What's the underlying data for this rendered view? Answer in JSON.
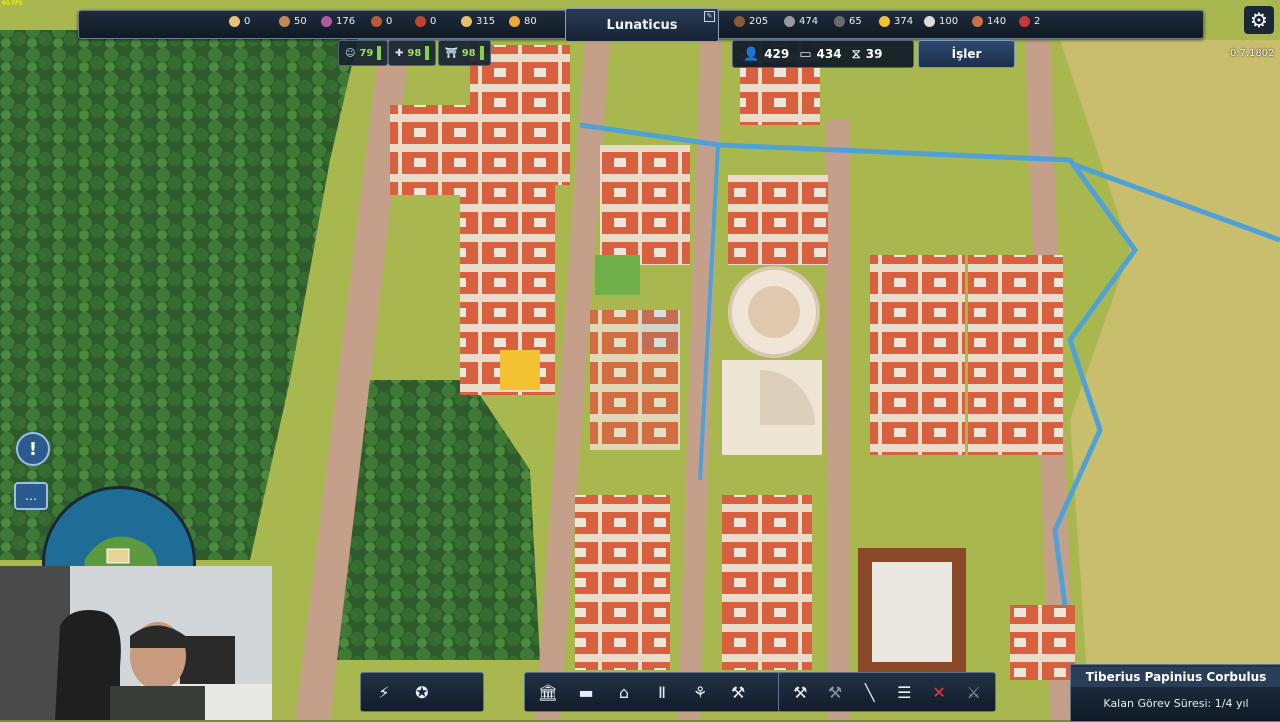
{
  "fps_text": "60 FPS",
  "city": {
    "name": "Lunaticus"
  },
  "resources_left": [
    {
      "icon": "bread-icon",
      "value": "0",
      "color": "#e8c07a"
    },
    {
      "icon": "amphora-icon",
      "value": "50",
      "color": "#c48a5a"
    },
    {
      "icon": "grapes-icon",
      "value": "176",
      "color": "#b05a9a"
    },
    {
      "icon": "pottery-icon",
      "value": "0",
      "color": "#b65a3a"
    },
    {
      "icon": "meat-icon",
      "value": "0",
      "color": "#c0452e"
    },
    {
      "icon": "wheat-icon",
      "value": "315",
      "color": "#e3c16a"
    },
    {
      "icon": "fish-icon",
      "value": "80",
      "color": "#e8a83a"
    }
  ],
  "resources_right": [
    {
      "icon": "wood-icon",
      "value": "205",
      "color": "#8a5a32"
    },
    {
      "icon": "stone-icon",
      "value": "474",
      "color": "#9a9a9a"
    },
    {
      "icon": "iron-icon",
      "value": "65",
      "color": "#6b6b6b"
    },
    {
      "icon": "coin-icon",
      "value": "374",
      "color": "#f2c230"
    },
    {
      "icon": "marble-icon",
      "value": "100",
      "color": "#dcdcdc"
    },
    {
      "icon": "clay-icon",
      "value": "140",
      "color": "#c8704a"
    },
    {
      "icon": "wine-icon",
      "value": "2",
      "color": "#c23a3a"
    }
  ],
  "stats": [
    {
      "icon": "happiness-icon",
      "value": "79"
    },
    {
      "icon": "health-icon",
      "value": "98"
    },
    {
      "icon": "culture-icon",
      "value": "98"
    }
  ],
  "population": [
    {
      "icon": "person-icon",
      "glyph": "👤",
      "value": "429"
    },
    {
      "icon": "bed-icon",
      "glyph": "▭",
      "value": "434"
    },
    {
      "icon": "workers-icon",
      "glyph": "⧖",
      "value": "39"
    }
  ],
  "jobs_button": "İşler",
  "version": "0.7.1802",
  "alert_glyph": "!",
  "chat_glyph": "…",
  "bottom_left_buttons": [
    {
      "name": "lightning-button",
      "glyph": "⚡"
    },
    {
      "name": "star-wreath-button",
      "glyph": "✪"
    }
  ],
  "build_buttons": [
    {
      "name": "temple-button",
      "glyph": "🏛"
    },
    {
      "name": "wall-button",
      "glyph": "▬"
    },
    {
      "name": "gate-button",
      "glyph": "⌂"
    },
    {
      "name": "column-button",
      "glyph": "Ⅱ"
    },
    {
      "name": "wheat-button",
      "glyph": "⚘"
    },
    {
      "name": "hammer-button",
      "glyph": "⚒"
    }
  ],
  "tool_buttons": [
    {
      "name": "build-tools-button",
      "glyph": "⚒",
      "state": "normal"
    },
    {
      "name": "demolish-button",
      "glyph": "⚒",
      "state": "disabled"
    },
    {
      "name": "road-button",
      "glyph": "╲",
      "state": "normal"
    },
    {
      "name": "aqueduct-button",
      "glyph": "☰",
      "state": "normal"
    },
    {
      "name": "cancel-button",
      "glyph": "✕",
      "state": "red"
    },
    {
      "name": "sword-button",
      "glyph": "⚔",
      "state": "disabled"
    }
  ],
  "governor": {
    "name": "Tiberius Papinius Corbulus",
    "term": "Kalan Görev Süresi: 1/4 yıl"
  },
  "colors": {
    "bar_bg": "#101923",
    "accent_blue": "#2a5a8e",
    "roof_red": "#d8553a",
    "roof_orange": "#e0743e",
    "grass": "#a9b84e",
    "forest": "#2f5a2c",
    "road": "#c4a08a",
    "aqueduct": "#4ea2d8"
  }
}
